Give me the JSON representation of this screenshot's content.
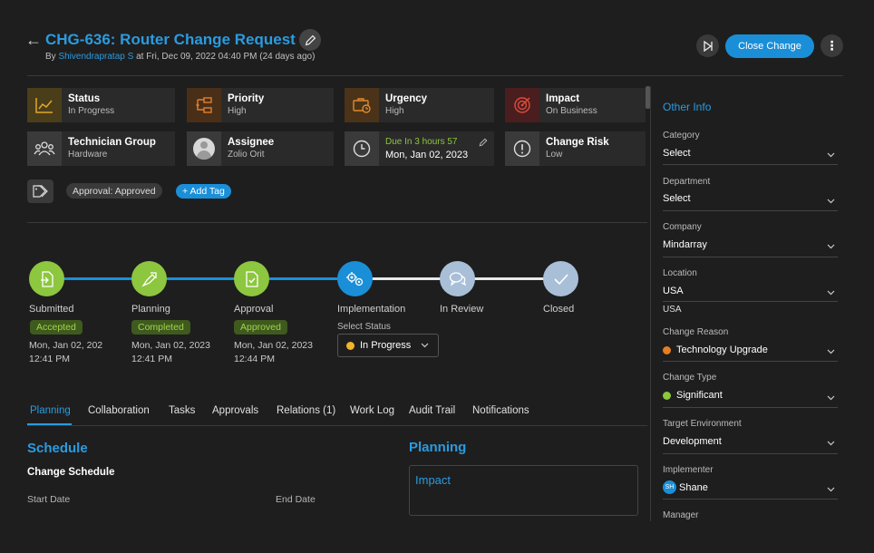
{
  "header": {
    "title": "CHG-636: Router Change Request",
    "by_prefix": "By",
    "author": "Shivendrapratap S",
    "timestamp": "at Fri, Dec 09, 2022 04:40 PM (24 days ago)",
    "close_label": "Close Change"
  },
  "tiles": {
    "status": {
      "label": "Status",
      "value": "In Progress"
    },
    "priority": {
      "label": "Priority",
      "value": "High"
    },
    "urgency": {
      "label": "Urgency",
      "value": "High"
    },
    "impact": {
      "label": "Impact",
      "value": "On Business"
    },
    "technician_group": {
      "label": "Technician Group",
      "value": "Hardware"
    },
    "assignee": {
      "label": "Assignee",
      "value": "Zolio Orit"
    },
    "due": {
      "label": "Due In 3 hours 57",
      "value": "Mon, Jan 02, 2023"
    },
    "change_risk": {
      "label": "Change Risk",
      "value": "Low"
    }
  },
  "tags": {
    "approval_chip": "Approval: Approved",
    "add_tag": "+ Add Tag"
  },
  "stepper": [
    {
      "label": "Submitted",
      "badge": "Accepted",
      "date": "Mon, Jan 02, 202",
      "time": "12:41 PM"
    },
    {
      "label": "Planning",
      "badge": "Completed",
      "date": "Mon, Jan 02, 2023",
      "time": "12:41 PM"
    },
    {
      "label": "Approval",
      "badge": "Approved",
      "date": "Mon, Jan 02, 2023",
      "time": "12:44 PM"
    },
    {
      "label": "Implementation"
    },
    {
      "label": "In Review"
    },
    {
      "label": "Closed"
    }
  ],
  "status_select": {
    "label": "Select Status",
    "value": "In Progress"
  },
  "tabs": [
    "Planning",
    "Collaboration",
    "Tasks",
    "Approvals",
    "Relations (1)",
    "Work Log",
    "Audit Trail",
    "Notifications"
  ],
  "schedule": {
    "title": "Schedule",
    "subtitle": "Change Schedule",
    "start_label": "Start Date",
    "end_label": "End Date"
  },
  "planning": {
    "title": "Planning",
    "impact_title": "Impact"
  },
  "other_info": {
    "title": "Other Info",
    "category": {
      "label": "Category",
      "value": "Select"
    },
    "department": {
      "label": "Department",
      "value": "Select"
    },
    "company": {
      "label": "Company",
      "value": "Mindarray"
    },
    "location": {
      "label": "Location",
      "value": "USA",
      "extra": "USA"
    },
    "change_reason": {
      "label": "Change Reason",
      "value": "Technology Upgrade"
    },
    "change_type": {
      "label": "Change Type",
      "value": "Significant"
    },
    "target_environment": {
      "label": "Target Environment",
      "value": "Development"
    },
    "implementer": {
      "label": "Implementer",
      "value": "Shane",
      "initials": "SH"
    },
    "manager": {
      "label": "Manager"
    }
  },
  "colors": {
    "accent": "#2b9be0",
    "green": "#8dc63f",
    "orange": "#e67e22"
  }
}
